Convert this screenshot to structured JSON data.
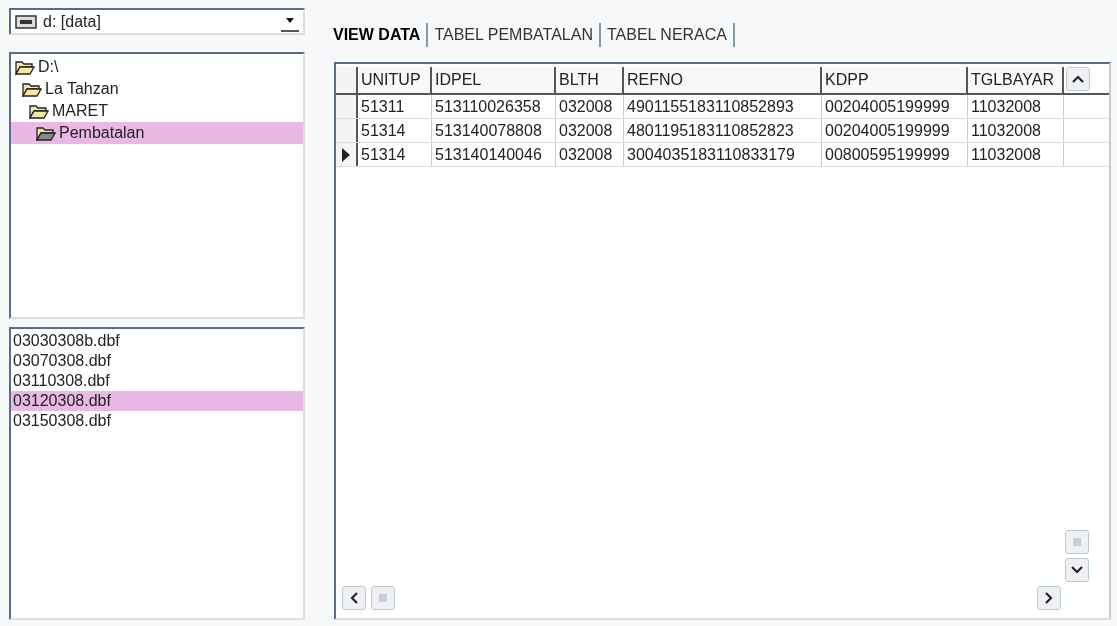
{
  "drive_combo": {
    "value": "d: [data]"
  },
  "folder_tree": [
    {
      "label": "D:\\",
      "selected": false,
      "children": [
        {
          "label": "La Tahzan",
          "selected": false,
          "children": [
            {
              "label": "MARET",
              "selected": false,
              "children": [
                {
                  "label": "Pembatalan",
                  "selected": true
                }
              ]
            }
          ]
        }
      ]
    }
  ],
  "file_list": [
    {
      "name": "03030308b.dbf",
      "selected": false
    },
    {
      "name": "03070308.dbf",
      "selected": false
    },
    {
      "name": "03110308.dbf",
      "selected": false
    },
    {
      "name": "03120308.dbf",
      "selected": true
    },
    {
      "name": "03150308.dbf",
      "selected": false
    }
  ],
  "tabs": [
    {
      "label": "VIEW DATA",
      "selected": true
    },
    {
      "label": "TABEL PEMBATALAN",
      "selected": false
    },
    {
      "label": "TABEL NERACA",
      "selected": false
    }
  ],
  "table": {
    "columns": [
      "UNITUP",
      "IDPEL",
      "BLTH",
      "REFNO",
      "KDPP",
      "TGLBAYAR"
    ],
    "rows": [
      {
        "current": false,
        "cells": [
          "51311",
          "513110026358",
          "032008",
          "4901155183110852893",
          "00204005199999",
          "11032008"
        ]
      },
      {
        "current": false,
        "cells": [
          "51314",
          "513140078808",
          "032008",
          "4801195183110852823",
          "00204005199999",
          "11032008"
        ]
      },
      {
        "current": true,
        "cells": [
          "51314",
          "513140140046",
          "032008",
          "3004035183110833179",
          "00800595199999",
          "11032008"
        ]
      }
    ]
  }
}
